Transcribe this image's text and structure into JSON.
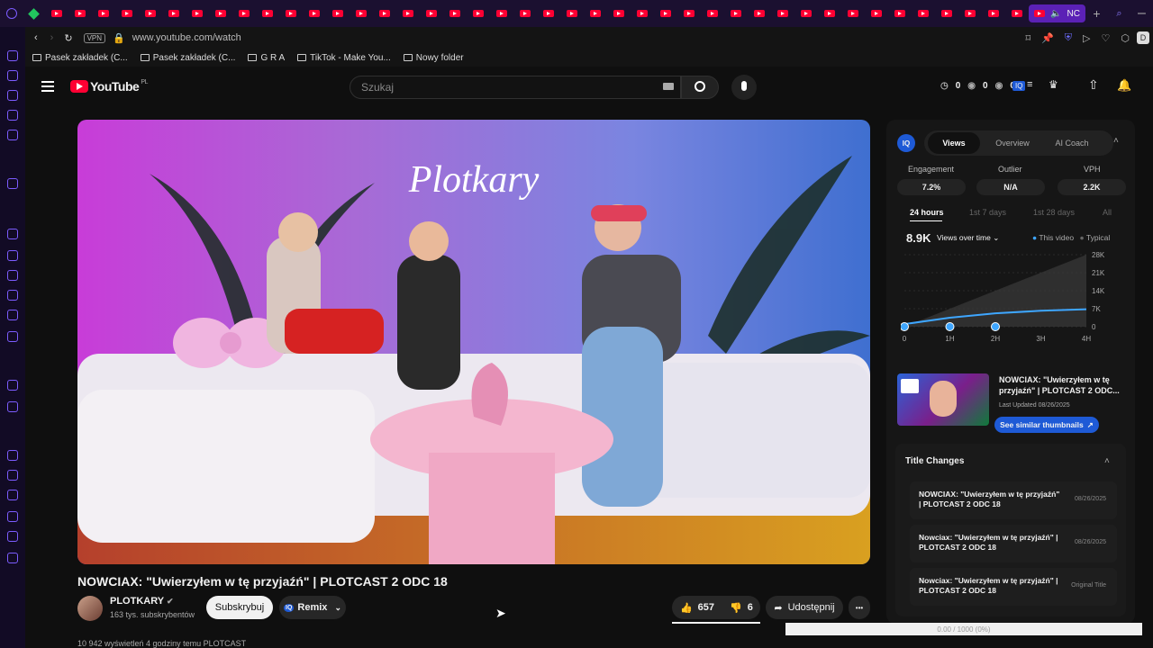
{
  "browser": {
    "active_tab_label": "NC",
    "url": "www.youtube.com/watch",
    "vpn_badge": "VPN",
    "profile_initial": "D",
    "bookmarks": [
      "Pasek zakładek (C...",
      "Pasek zakładek (C...",
      "G R A",
      "TikTok - Make You...",
      "Nowy folder"
    ]
  },
  "yt": {
    "logo_text": "YouTube",
    "region": "PL",
    "search_placeholder": "Szukaj",
    "counters": [
      "0",
      "0",
      "0"
    ],
    "ext_badge": "IQ"
  },
  "video": {
    "neon_sign": "Plotkary",
    "title": "NOWCIAX: \"Uwierzyłem w tę przyjaźń\" | PLOTCAST 2 ODC 18",
    "channel_name": "PLOTKARY",
    "subscribers": "163 tys. subskrybentów",
    "subscribe_label": "Subskrybuj",
    "remix_label": "Remix",
    "likes": "657",
    "dislikes": "6",
    "share_label": "Udostępnij",
    "more_label": "•••",
    "bottom_line": "10 942 wyświetleń  4 godziny temu  PLOTCAST"
  },
  "panel": {
    "badge": "IQ",
    "tabs": [
      "Views",
      "Overview",
      "AI Coach"
    ],
    "stats": [
      {
        "label": "Engagement",
        "value": "7.2%"
      },
      {
        "label": "Outlier",
        "value": "N/A"
      },
      {
        "label": "VPH",
        "value": "2.2K"
      }
    ],
    "ranges": [
      "24 hours",
      "1st 7 days",
      "1st 28 days",
      "All"
    ],
    "views_total": "8.9K",
    "views_dropdown": "Views over time",
    "legend_this": "This video",
    "legend_typical": "Typical",
    "similar": {
      "title": "NOWCIAX: \"Uwierzyłem w tę przyjaźń\" | PLOTCAST 2 ODC...",
      "updated": "Last Updated 08/26/2025",
      "button": "See similar thumbnails"
    },
    "title_changes_heading": "Title Changes",
    "title_changes": [
      {
        "text": "NOWCIAX: \"Uwierzyłem w tę przyjaźń\" | PLOTCAST 2 ODC 18",
        "date": "08/26/2025"
      },
      {
        "text": "Nowciax: \"Uwierzyłem w tę przyjaźń\" | PLOTCAST 2 ODC 18",
        "date": "08/26/2025"
      },
      {
        "text": "Nowciax: \"Uwierzyłem w tę przyjaźń\" | PLOTCAST 2 ODC 18",
        "date": "Original Title"
      }
    ]
  },
  "chart_data": {
    "type": "line",
    "x": [
      "0",
      "1H",
      "2H",
      "3H",
      "4H"
    ],
    "y_ticks": [
      "28K",
      "21K",
      "14K",
      "7K",
      "0"
    ],
    "ylim": [
      0,
      28000
    ],
    "series": [
      {
        "name": "This video",
        "values": [
          1000,
          3500,
          5200,
          6200,
          6800
        ]
      }
    ],
    "typical_band_top": [
      0,
      7000,
      14000,
      21000,
      28000
    ]
  },
  "footer": {
    "progress_text": "0.00 / 1000 (0%)"
  }
}
